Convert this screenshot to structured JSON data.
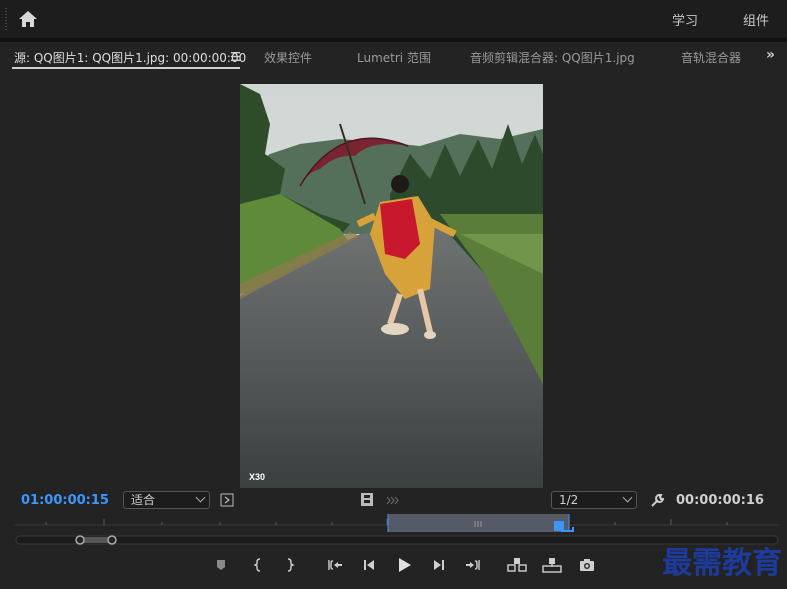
{
  "topbar": {
    "home_icon": "home-icon",
    "workspaces": [
      "学习",
      "组件"
    ]
  },
  "tabs": {
    "source": "源: QQ图片1: QQ图片1.jpg: 00:00:00:00",
    "effects": "效果控件",
    "lumetri": "Lumetri 范围",
    "audio_mixer": "音频剪辑混合器: QQ图片1.jpg",
    "track_mixer": "音轨混合器",
    "overflow_icon": "double-chevron-right-icon"
  },
  "monitor": {
    "playhead_timecode": "01:00:00:15",
    "fit_select": "适合",
    "resolution_select": "1/2",
    "duration_timecode": "00:00:00:16",
    "photo_caption": "X30"
  },
  "colors": {
    "accent": "#3d96ff",
    "background": "#232323",
    "topbar": "#1d1d1d",
    "watermark": "#1e3a9a"
  },
  "transport": {
    "icons": [
      "marker-icon",
      "mark-in-icon",
      "mark-out-icon",
      "go-to-in-icon",
      "step-back-icon",
      "play-icon",
      "step-forward-icon",
      "go-to-out-icon",
      "insert-icon",
      "overwrite-icon",
      "export-frame-icon"
    ]
  },
  "watermark": "最需教育"
}
